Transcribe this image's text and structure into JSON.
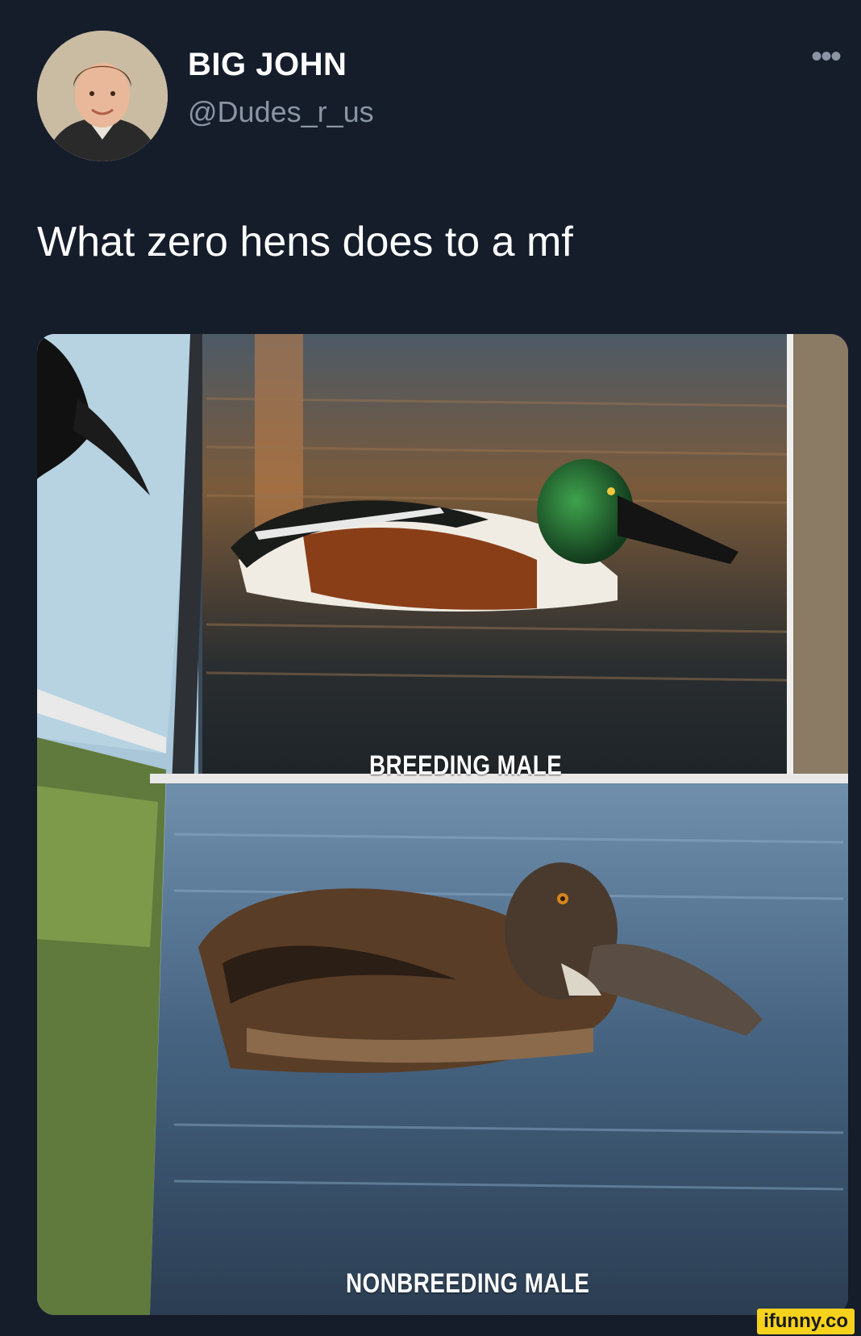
{
  "tweet": {
    "display_name": "BIG JOHN",
    "handle": "@Dudes_r_us",
    "more_icon": "more-options-icon",
    "text": "What zero hens does to a mf"
  },
  "photo": {
    "top_caption": "BREEDING MALE",
    "bottom_caption": "NONBREEDING MALE"
  },
  "watermark": {
    "text": "ifunny.co",
    "color": "#f7d21c"
  },
  "colors": {
    "background": "#151d2b",
    "text": "#ffffff",
    "muted": "#8a95a3"
  }
}
